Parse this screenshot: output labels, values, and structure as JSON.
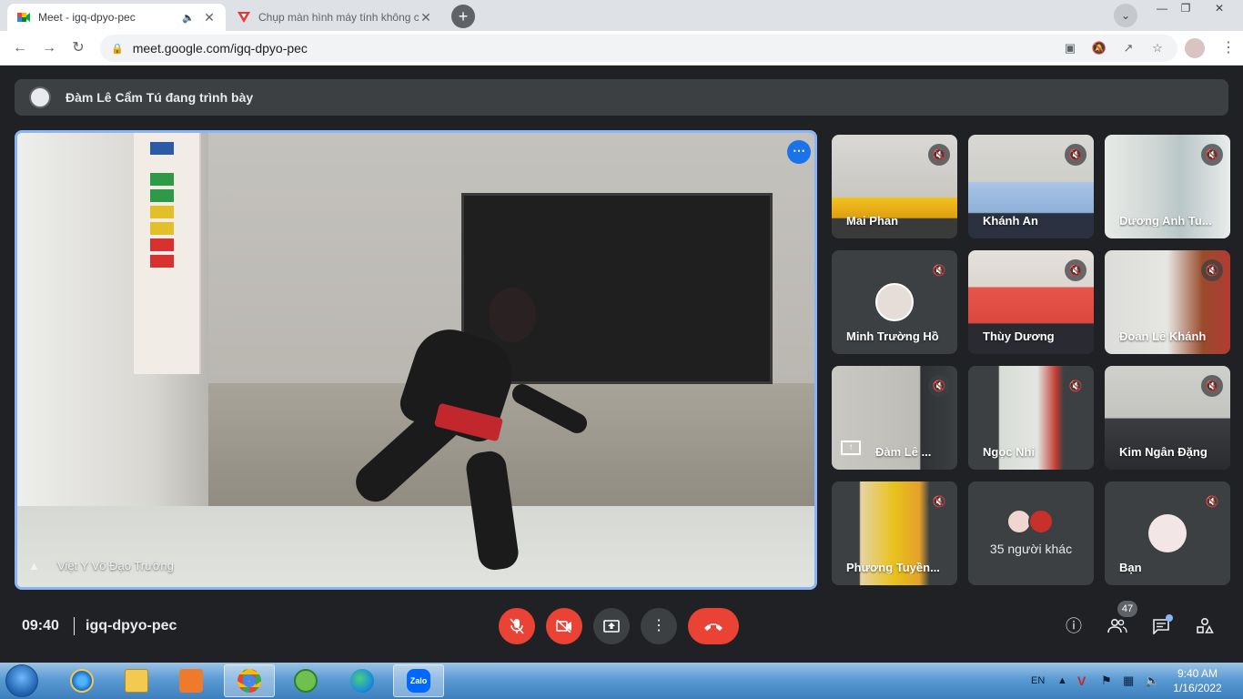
{
  "browser": {
    "tabs": [
      {
        "title": "Meet - igq-dpyo-pec",
        "active": true
      },
      {
        "title": "Chụp màn hình máy tính không c",
        "active": false
      }
    ],
    "url": "meet.google.com/igq-dpyo-pec"
  },
  "meet": {
    "presenting_text": "Đàm Lê Cẩm Tú đang trình bày",
    "stage": {
      "name": "Việt Y Võ Đạo Trường"
    },
    "participants": [
      {
        "name": "Mai Phan",
        "muted": true
      },
      {
        "name": "Khánh An",
        "muted": true
      },
      {
        "name": "Dương Anh Tu...",
        "muted": true
      },
      {
        "name": "Minh Trường Hồ",
        "muted": true
      },
      {
        "name": "Thùy Dương",
        "muted": true
      },
      {
        "name": "Đoan Lê Khánh",
        "muted": true
      },
      {
        "name": "Đàm Lê ...",
        "muted": true
      },
      {
        "name": "Ngọc Nhi",
        "muted": true
      },
      {
        "name": "Kim Ngân Đặng",
        "muted": true
      },
      {
        "name": "Phương Tuyền...",
        "muted": true
      },
      {
        "name": "35 người khác",
        "muted": false
      },
      {
        "name": "Bạn",
        "muted": true
      }
    ],
    "bottom": {
      "time": "09:40",
      "meeting_code": "igq-dpyo-pec",
      "participant_count": "47"
    }
  },
  "taskbar": {
    "language": "EN",
    "time": "9:40 AM",
    "date": "1/16/2022",
    "zalo_label": "Zalo"
  },
  "colors": {
    "meet_bg": "#202124",
    "red": "#ea4335",
    "accent_blue": "#8ab4f8"
  }
}
